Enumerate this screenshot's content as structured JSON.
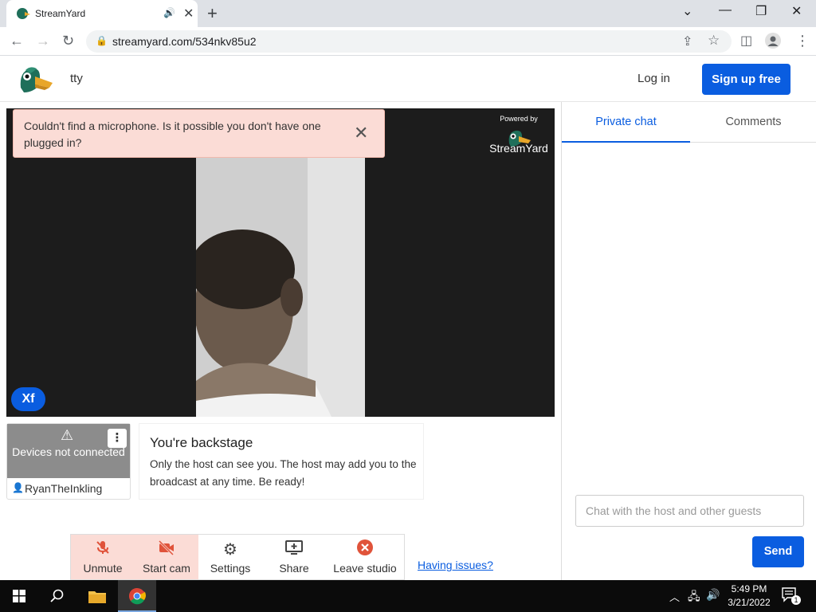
{
  "browser": {
    "tab_title": "StreamYard",
    "url": "streamyard.com/534nkv85u2"
  },
  "header": {
    "studio_name": "tty",
    "login_label": "Log in",
    "signup_label": "Sign up free"
  },
  "stage": {
    "powered_by": "Powered by",
    "brand": "StreamYard",
    "badge": "Xf"
  },
  "alert": {
    "message": "Couldn't find a microphone. Is it possible you don't have one plugged in?"
  },
  "participant": {
    "status": "Devices not connected",
    "name": "RyanTheInkling"
  },
  "backstage": {
    "title": "You're backstage",
    "text": "Only the host can see you. The host may add you to the broadcast at any time. Be ready!"
  },
  "controls": [
    {
      "label": "Unmute",
      "icon": "mic-off-icon",
      "color": "#e0533a"
    },
    {
      "label": "Start cam",
      "icon": "camera-off-icon",
      "color": "#e0533a"
    },
    {
      "label": "Settings",
      "icon": "gear-icon",
      "color": "#444444"
    },
    {
      "label": "Share",
      "icon": "screen-share-icon",
      "color": "#444444"
    },
    {
      "label": "Leave studio",
      "icon": "leave-icon",
      "color": "#e0533a"
    }
  ],
  "having_issues": "Having issues?",
  "sidebar": {
    "tabs": [
      "Private chat",
      "Comments"
    ],
    "input_placeholder": "Chat with the host and other guests",
    "send_label": "Send"
  },
  "taskbar": {
    "time": "5:49 PM",
    "date": "3/21/2022",
    "notifications": "1"
  },
  "colors": {
    "accent": "#0a5de0",
    "alert_bg": "#fbdcd6",
    "danger": "#e0533a"
  }
}
